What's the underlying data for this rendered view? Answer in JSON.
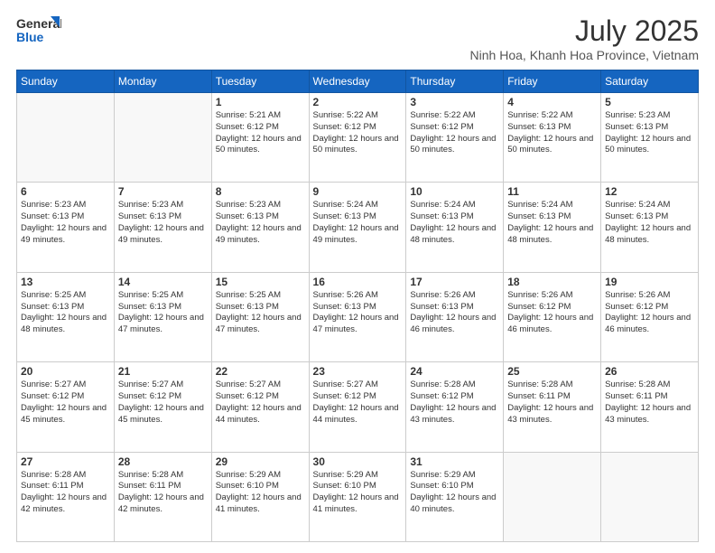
{
  "header": {
    "logo_line1": "General",
    "logo_line2": "Blue",
    "month": "July 2025",
    "location": "Ninh Hoa, Khanh Hoa Province, Vietnam"
  },
  "weekdays": [
    "Sunday",
    "Monday",
    "Tuesday",
    "Wednesday",
    "Thursday",
    "Friday",
    "Saturday"
  ],
  "weeks": [
    [
      {
        "day": "",
        "info": ""
      },
      {
        "day": "",
        "info": ""
      },
      {
        "day": "1",
        "info": "Sunrise: 5:21 AM\nSunset: 6:12 PM\nDaylight: 12 hours and 50 minutes."
      },
      {
        "day": "2",
        "info": "Sunrise: 5:22 AM\nSunset: 6:12 PM\nDaylight: 12 hours and 50 minutes."
      },
      {
        "day": "3",
        "info": "Sunrise: 5:22 AM\nSunset: 6:12 PM\nDaylight: 12 hours and 50 minutes."
      },
      {
        "day": "4",
        "info": "Sunrise: 5:22 AM\nSunset: 6:13 PM\nDaylight: 12 hours and 50 minutes."
      },
      {
        "day": "5",
        "info": "Sunrise: 5:23 AM\nSunset: 6:13 PM\nDaylight: 12 hours and 50 minutes."
      }
    ],
    [
      {
        "day": "6",
        "info": "Sunrise: 5:23 AM\nSunset: 6:13 PM\nDaylight: 12 hours and 49 minutes."
      },
      {
        "day": "7",
        "info": "Sunrise: 5:23 AM\nSunset: 6:13 PM\nDaylight: 12 hours and 49 minutes."
      },
      {
        "day": "8",
        "info": "Sunrise: 5:23 AM\nSunset: 6:13 PM\nDaylight: 12 hours and 49 minutes."
      },
      {
        "day": "9",
        "info": "Sunrise: 5:24 AM\nSunset: 6:13 PM\nDaylight: 12 hours and 49 minutes."
      },
      {
        "day": "10",
        "info": "Sunrise: 5:24 AM\nSunset: 6:13 PM\nDaylight: 12 hours and 48 minutes."
      },
      {
        "day": "11",
        "info": "Sunrise: 5:24 AM\nSunset: 6:13 PM\nDaylight: 12 hours and 48 minutes."
      },
      {
        "day": "12",
        "info": "Sunrise: 5:24 AM\nSunset: 6:13 PM\nDaylight: 12 hours and 48 minutes."
      }
    ],
    [
      {
        "day": "13",
        "info": "Sunrise: 5:25 AM\nSunset: 6:13 PM\nDaylight: 12 hours and 48 minutes."
      },
      {
        "day": "14",
        "info": "Sunrise: 5:25 AM\nSunset: 6:13 PM\nDaylight: 12 hours and 47 minutes."
      },
      {
        "day": "15",
        "info": "Sunrise: 5:25 AM\nSunset: 6:13 PM\nDaylight: 12 hours and 47 minutes."
      },
      {
        "day": "16",
        "info": "Sunrise: 5:26 AM\nSunset: 6:13 PM\nDaylight: 12 hours and 47 minutes."
      },
      {
        "day": "17",
        "info": "Sunrise: 5:26 AM\nSunset: 6:13 PM\nDaylight: 12 hours and 46 minutes."
      },
      {
        "day": "18",
        "info": "Sunrise: 5:26 AM\nSunset: 6:12 PM\nDaylight: 12 hours and 46 minutes."
      },
      {
        "day": "19",
        "info": "Sunrise: 5:26 AM\nSunset: 6:12 PM\nDaylight: 12 hours and 46 minutes."
      }
    ],
    [
      {
        "day": "20",
        "info": "Sunrise: 5:27 AM\nSunset: 6:12 PM\nDaylight: 12 hours and 45 minutes."
      },
      {
        "day": "21",
        "info": "Sunrise: 5:27 AM\nSunset: 6:12 PM\nDaylight: 12 hours and 45 minutes."
      },
      {
        "day": "22",
        "info": "Sunrise: 5:27 AM\nSunset: 6:12 PM\nDaylight: 12 hours and 44 minutes."
      },
      {
        "day": "23",
        "info": "Sunrise: 5:27 AM\nSunset: 6:12 PM\nDaylight: 12 hours and 44 minutes."
      },
      {
        "day": "24",
        "info": "Sunrise: 5:28 AM\nSunset: 6:12 PM\nDaylight: 12 hours and 43 minutes."
      },
      {
        "day": "25",
        "info": "Sunrise: 5:28 AM\nSunset: 6:11 PM\nDaylight: 12 hours and 43 minutes."
      },
      {
        "day": "26",
        "info": "Sunrise: 5:28 AM\nSunset: 6:11 PM\nDaylight: 12 hours and 43 minutes."
      }
    ],
    [
      {
        "day": "27",
        "info": "Sunrise: 5:28 AM\nSunset: 6:11 PM\nDaylight: 12 hours and 42 minutes."
      },
      {
        "day": "28",
        "info": "Sunrise: 5:28 AM\nSunset: 6:11 PM\nDaylight: 12 hours and 42 minutes."
      },
      {
        "day": "29",
        "info": "Sunrise: 5:29 AM\nSunset: 6:10 PM\nDaylight: 12 hours and 41 minutes."
      },
      {
        "day": "30",
        "info": "Sunrise: 5:29 AM\nSunset: 6:10 PM\nDaylight: 12 hours and 41 minutes."
      },
      {
        "day": "31",
        "info": "Sunrise: 5:29 AM\nSunset: 6:10 PM\nDaylight: 12 hours and 40 minutes."
      },
      {
        "day": "",
        "info": ""
      },
      {
        "day": "",
        "info": ""
      }
    ]
  ]
}
